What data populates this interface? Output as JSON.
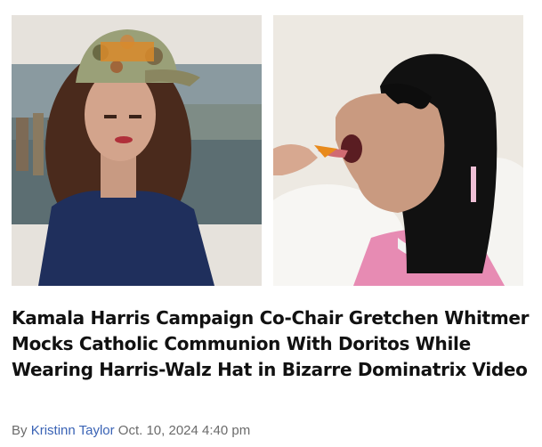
{
  "article": {
    "headline": "Kamala Harris Campaign Co-Chair Gretchen Whitmer Mocks Catholic Communion With Doritos While Wearing Harris-Walz Hat in Bizarre Dominatrix Video",
    "byline_prefix": "By",
    "author": "Kristinn Taylor",
    "date": "Oct. 10, 2024 4:40 pm"
  },
  "colors": {
    "headline": "#111111",
    "author_link": "#3a63b5",
    "meta_text": "#6b6b6b"
  },
  "images": [
    {
      "name": "photo-woman-in-camo-cap"
    },
    {
      "name": "photo-woman-receiving-chip"
    }
  ]
}
